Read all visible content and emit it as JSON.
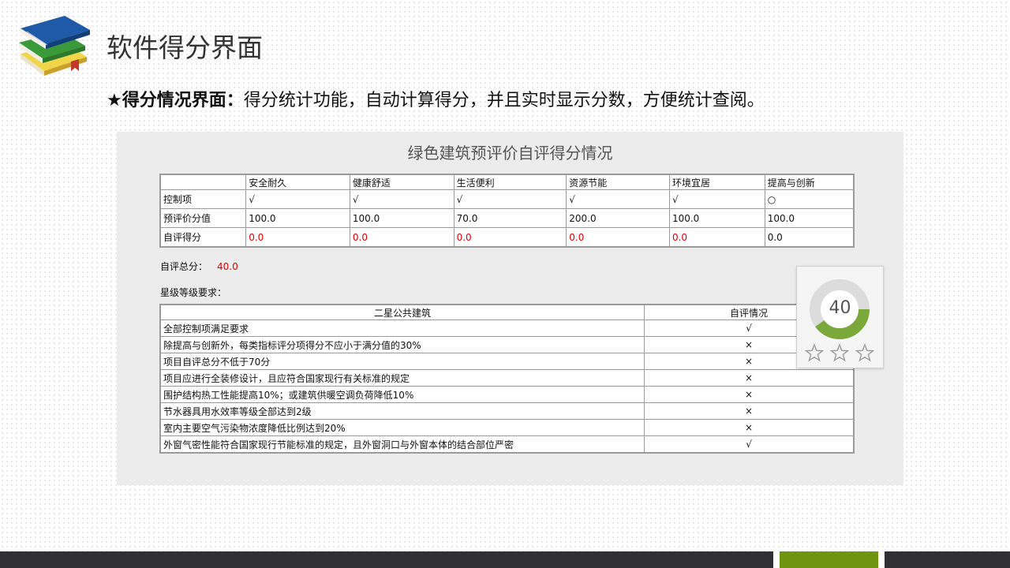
{
  "page": {
    "title": "软件得分界面",
    "subtitle_lead": "★得分情况界面：",
    "subtitle_body": "得分统计功能，自动计算得分，并且实时显示分数，方便统计查阅。"
  },
  "panel": {
    "title": "绿色建筑预评价自评得分情况",
    "score_table": {
      "headers": [
        "",
        "安全耐久",
        "健康舒适",
        "生活便利",
        "资源节能",
        "环境宜居",
        "提高与创新"
      ],
      "rows": [
        {
          "label": "控制项",
          "cells": [
            "√",
            "√",
            "√",
            "√",
            "√",
            "○"
          ]
        },
        {
          "label": "预评价分值",
          "cells": [
            "100.0",
            "100.0",
            "70.0",
            "200.0",
            "100.0",
            "100.0"
          ]
        },
        {
          "label": "自评得分",
          "cells": [
            "0.0",
            "0.0",
            "0.0",
            "0.0",
            "0.0",
            "0.0"
          ]
        }
      ]
    },
    "total_label": "自评总分：",
    "total_value": "40.0",
    "req_label": "星级等级要求：",
    "req_table": {
      "headers": [
        "二星公共建筑",
        "自评情况"
      ],
      "rows": [
        {
          "req": "全部控制项满足要求",
          "status": "√"
        },
        {
          "req": "除提高与创新外，每类指标评分项得分不应小于满分值的30%",
          "status": "×"
        },
        {
          "req": "项目自评总分不低于70分",
          "status": "×"
        },
        {
          "req": "项目应进行全装修设计，且应符合国家现行有关标准的规定",
          "status": "×"
        },
        {
          "req": "围护结构热工性能提高10%；或建筑供暖空调负荷降低10%",
          "status": "×"
        },
        {
          "req": "节水器具用水效率等级全部达到2级",
          "status": "×"
        },
        {
          "req": "室内主要空气污染物浓度降低比例达到20%",
          "status": "×"
        },
        {
          "req": "外窗气密性能符合国家现行节能标准的规定，且外窗洞口与外窗本体的结合部位严密",
          "status": "√"
        }
      ]
    }
  },
  "badge": {
    "score": "40",
    "progress_fraction": 0.4,
    "stars_filled": 0,
    "stars_total": 3,
    "ring_color": "#7aa83a",
    "ring_track_color": "#dcdcdc"
  },
  "colors": {
    "footer_dark": "#2f2f34",
    "footer_accent": "#6f9410",
    "score_red": "#e00000"
  },
  "icons": {
    "logo": "stacked-books-icon",
    "star": "star-outline-icon"
  }
}
